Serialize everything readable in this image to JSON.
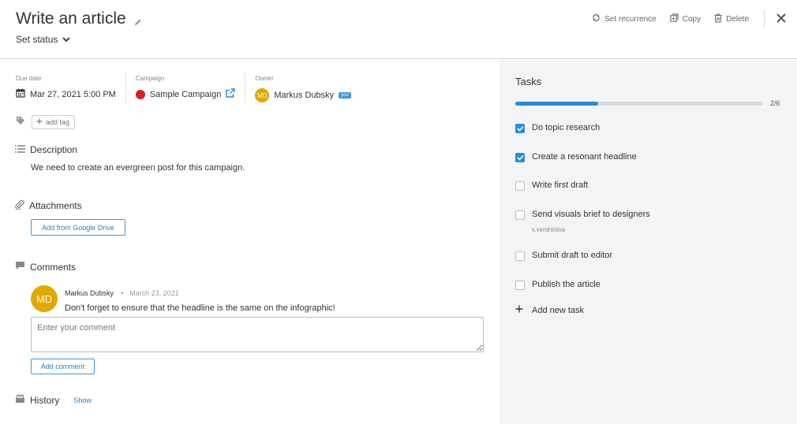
{
  "header": {
    "title": "Write an article",
    "set_status": "Set status",
    "actions": {
      "set_recurrence": "Set recurrence",
      "copy": "Copy",
      "delete": "Delete"
    }
  },
  "meta": {
    "due_date_label": "Due date",
    "due_date_value": "Mar 27, 2021 5:00 PM",
    "campaign_label": "Campaign",
    "campaign_value": "Sample Campaign",
    "campaign_color": "#d4202a",
    "owner_label": "Owner",
    "owner_initials": "MD",
    "owner_name": "Markus Dubsky",
    "owner_badge": "you"
  },
  "tags": {
    "add_tag": "add tag"
  },
  "description": {
    "heading": "Description",
    "text": "We need to create an evergreen post for this campaign."
  },
  "attachments": {
    "heading": "Attachments",
    "add_button": "Add from Google Drive"
  },
  "comments": {
    "heading": "Comments",
    "items": [
      {
        "initials": "MD",
        "author": "Markus Dubsky",
        "separator": "•",
        "date": "March 23, 2021",
        "text": "Don't forget to ensure that the headline is the same on the infographic!"
      }
    ],
    "input_placeholder": "Enter your comment",
    "add_button": "Add comment"
  },
  "history": {
    "heading": "History",
    "show": "Show"
  },
  "tasks": {
    "heading": "Tasks",
    "progress_text": "2/6",
    "progress_fraction": 0.333,
    "items": [
      {
        "label": "Do topic research",
        "checked": true
      },
      {
        "label": "Create a resonant headline",
        "checked": true
      },
      {
        "label": "Write first draft",
        "checked": false
      },
      {
        "label": "Send visuals brief to designers",
        "checked": false,
        "assignee": "v.vershinina"
      },
      {
        "label": "Submit draft to editor",
        "checked": false
      },
      {
        "label": "Publish the article",
        "checked": false
      }
    ],
    "add_task": "Add new task"
  },
  "colors": {
    "accent": "#2a8bd8",
    "avatar": "#e2a800",
    "panel_bg": "#f3f4f5"
  },
  "icons": [
    "pencil-icon",
    "chevron-down-icon",
    "recurrence-icon",
    "copy-icon",
    "trash-icon",
    "close-icon",
    "calendar-icon",
    "external-link-icon",
    "tag-icon",
    "plus-icon",
    "list-icon",
    "paperclip-icon",
    "comment-icon",
    "history-icon",
    "checkmark-icon"
  ]
}
